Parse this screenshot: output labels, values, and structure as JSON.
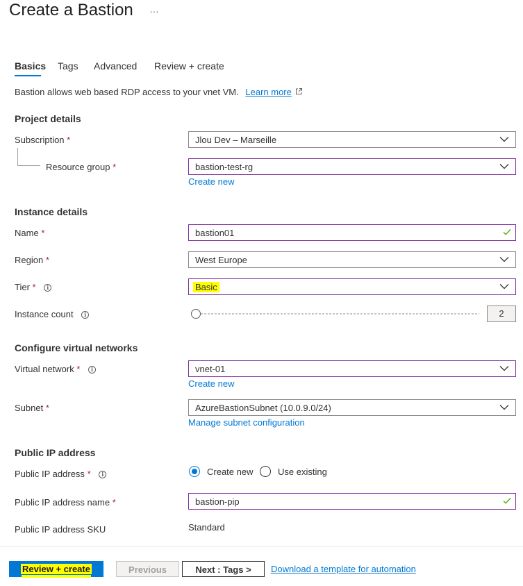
{
  "page": {
    "title": "Create a Bastion",
    "more_label": "…"
  },
  "tabs": [
    {
      "label": "Basics",
      "active": true
    },
    {
      "label": "Tags"
    },
    {
      "label": "Advanced"
    },
    {
      "label": "Review + create"
    }
  ],
  "intro": {
    "text": "Bastion allows web based RDP access to your vnet VM.",
    "link": "Learn more"
  },
  "project_details": {
    "heading": "Project details",
    "subscription_label": "Subscription",
    "subscription_value": "Jlou Dev – Marseille",
    "resource_group_label": "Resource group",
    "resource_group_value": "bastion-test-rg",
    "create_new": "Create new"
  },
  "instance_details": {
    "heading": "Instance details",
    "name_label": "Name",
    "name_value": "bastion01",
    "region_label": "Region",
    "region_value": "West Europe",
    "tier_label": "Tier",
    "tier_value": "Basic",
    "instance_count_label": "Instance count",
    "instance_count_value": "2"
  },
  "virtual_networks": {
    "heading": "Configure virtual networks",
    "vnet_label": "Virtual network",
    "vnet_value": "vnet-01",
    "create_new": "Create new",
    "subnet_label": "Subnet",
    "subnet_value": "AzureBastionSubnet (10.0.9.0/24)",
    "manage_subnet": "Manage subnet configuration"
  },
  "public_ip": {
    "heading": "Public IP address",
    "address_label": "Public IP address",
    "option_create": "Create new",
    "option_existing": "Use existing",
    "selected": "Create new",
    "name_label": "Public IP address name",
    "name_value": "bastion-pip",
    "sku_label": "Public IP address SKU",
    "sku_value": "Standard"
  },
  "required_mark": "*",
  "footer": {
    "review_create": "Review + create",
    "previous": "Previous",
    "next": "Next : Tags >",
    "download": "Download a template for automation"
  },
  "colors": {
    "accent": "#0078d4",
    "focus_border": "#7b2c9b",
    "highlight": "#ffff00",
    "required": "#a4262c",
    "valid_check": "#57a300"
  },
  "icons": [
    "more-icon",
    "external-link-icon",
    "chevron-down-icon",
    "checkmark-icon",
    "info-icon"
  ]
}
